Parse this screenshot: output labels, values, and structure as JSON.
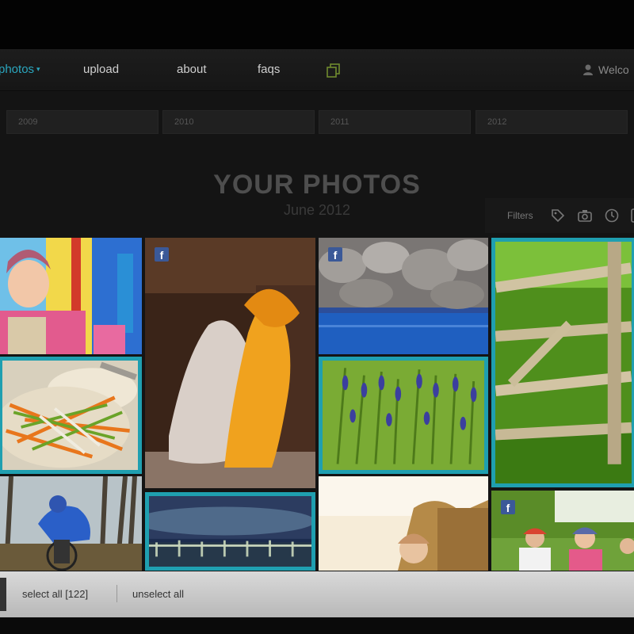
{
  "nav": {
    "photos": "photos",
    "photos_caret": "▾",
    "upload": "upload",
    "about": "about",
    "faqs": "faqs",
    "copy_icon": "copy-icon",
    "user_icon": "user-icon",
    "user_label": "Welco"
  },
  "years": [
    "2009",
    "2010",
    "2011",
    "2012"
  ],
  "page": {
    "title": "YOUR PHOTOS",
    "subtitle": "June 2012"
  },
  "filters": {
    "label": "Filters",
    "icons": [
      "tag-icon",
      "camera-icon",
      "clock-icon",
      "phone-icon"
    ]
  },
  "photos": [
    {
      "subject": "child on playground",
      "selected": false,
      "facebook": false
    },
    {
      "subject": "dancer in yellow dress",
      "selected": false,
      "facebook": true
    },
    {
      "subject": "rocks and sea",
      "selected": false,
      "facebook": true
    },
    {
      "subject": "wooden fence in grass",
      "selected": true,
      "facebook": false
    },
    {
      "subject": "vegetable salad",
      "selected": true,
      "facebook": false
    },
    {
      "subject": "lavender flowers",
      "selected": true,
      "facebook": false
    },
    {
      "subject": "cyclist in forest",
      "selected": false,
      "facebook": false
    },
    {
      "subject": "sky over harbor",
      "selected": true,
      "facebook": false
    },
    {
      "subject": "child in sunlight",
      "selected": false,
      "facebook": false
    },
    {
      "subject": "family on bikes",
      "selected": false,
      "facebook": true
    }
  ],
  "facebook_badge": "f",
  "bottom": {
    "select_all": "select all [122]",
    "unselect_all": "unselect all"
  },
  "colors": {
    "accent": "#1f9fb0",
    "nav_active": "#2aa7bf",
    "facebook": "#3b5998"
  }
}
